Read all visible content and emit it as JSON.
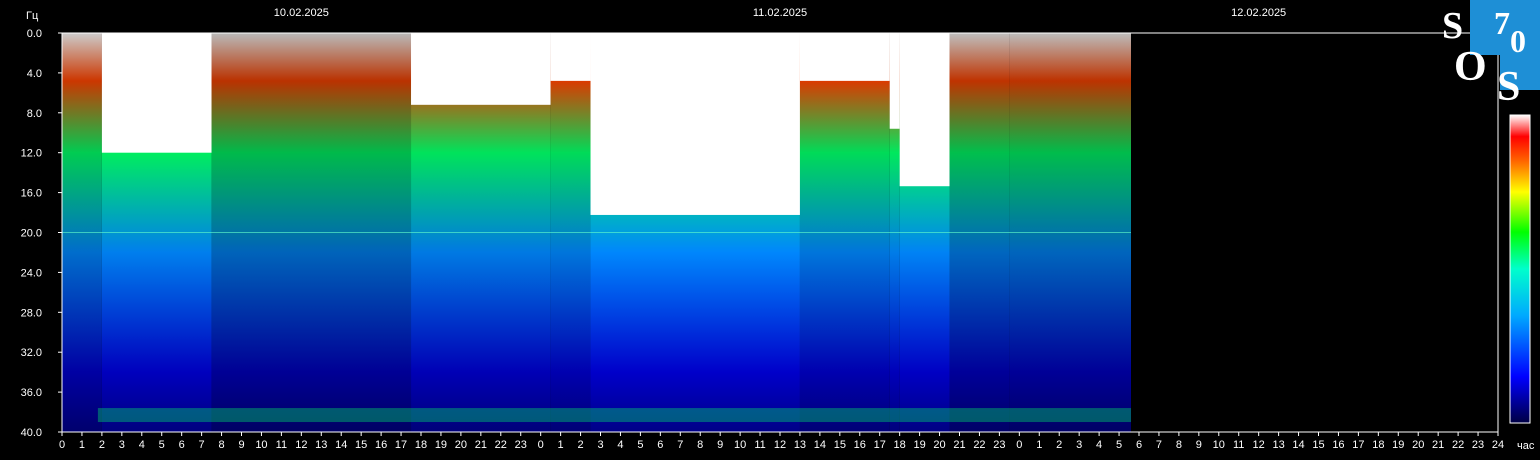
{
  "chart_data": {
    "type": "heatmap",
    "title": "",
    "ylabel": "Гц",
    "xlabel": "час",
    "ylim": [
      0,
      40
    ],
    "y_ticks": [
      "0.0",
      "4.0",
      "8.0",
      "12.0",
      "16.0",
      "20.0",
      "24.0",
      "28.0",
      "32.0",
      "36.0",
      "40.0"
    ],
    "x_ticks": [
      "0",
      "1",
      "2",
      "3",
      "4",
      "5",
      "6",
      "7",
      "8",
      "9",
      "10",
      "11",
      "12",
      "13",
      "14",
      "15",
      "16",
      "17",
      "18",
      "19",
      "20",
      "21",
      "22",
      "23",
      "0",
      "1",
      "2",
      "3",
      "4",
      "5",
      "6",
      "7",
      "8",
      "9",
      "10",
      "11",
      "12",
      "13",
      "14",
      "15",
      "16",
      "17",
      "18",
      "19",
      "20",
      "21",
      "22",
      "23",
      "0",
      "1",
      "2",
      "3",
      "4",
      "5",
      "6",
      "7",
      "8",
      "9",
      "10",
      "11",
      "12",
      "13",
      "14",
      "15",
      "16",
      "17",
      "18",
      "19",
      "20",
      "21",
      "22",
      "23",
      "24"
    ],
    "dates": [
      "10.02.2025",
      "11.02.2025",
      "12.02.2025"
    ],
    "data_end_hour": 53.6,
    "colorbar": [
      "#000066",
      "#0000ff",
      "#0066ff",
      "#00ffff",
      "#00ff00",
      "#ffff00",
      "#ff8800",
      "#ff0000",
      "#ffffff"
    ],
    "intensity_segments": [
      {
        "start": 0,
        "end": 2,
        "level": 0.55
      },
      {
        "start": 2,
        "end": 7.5,
        "level": 0.85
      },
      {
        "start": 7.5,
        "end": 17.5,
        "level": 0.4
      },
      {
        "start": 17.5,
        "end": 24.5,
        "level": 0.75
      },
      {
        "start": 24.5,
        "end": 26.5,
        "level": 0.7
      },
      {
        "start": 26.5,
        "end": 37,
        "level": 0.98
      },
      {
        "start": 37,
        "end": 41.5,
        "level": 0.7
      },
      {
        "start": 41.5,
        "end": 42,
        "level": 0.8
      },
      {
        "start": 42,
        "end": 44.5,
        "level": 0.92
      },
      {
        "start": 44.5,
        "end": 47.5,
        "level": 0.45
      },
      {
        "start": 47.5,
        "end": 53.6,
        "level": 0.42
      }
    ]
  },
  "logo": {
    "letters": [
      "S",
      "70",
      "O",
      "S"
    ],
    "bg": "#1e8fd6"
  }
}
